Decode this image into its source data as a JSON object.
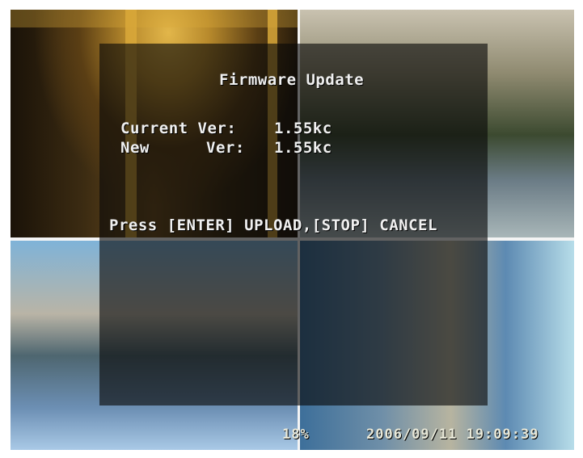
{
  "dialog": {
    "title": "Firmware Update",
    "current_label": "Current Ver:",
    "current_value": "1.55kc",
    "new_label": "New",
    "new_label_suffix": "Ver:",
    "new_value": "1.55kc",
    "prompt": "Press [ENTER] UPLOAD,[STOP] CANCEL"
  },
  "status_bar": {
    "progress_text": "18%",
    "datetime": "2006/09/11 19:09:39"
  }
}
